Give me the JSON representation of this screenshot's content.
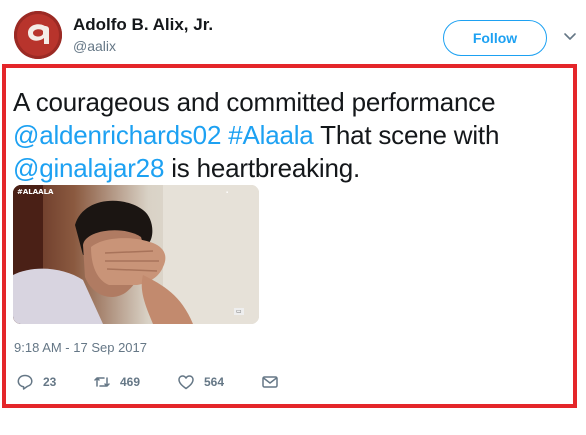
{
  "author": {
    "name": "Adolfo B. Alix, Jr.",
    "handle": "@aalix",
    "avatar_letter": "a"
  },
  "follow_label": "Follow",
  "tweet": {
    "segments": [
      {
        "text": "A courageous and committed performance ",
        "type": "text"
      },
      {
        "text": "@aldenrichards02",
        "type": "mention"
      },
      {
        "text": " ",
        "type": "text"
      },
      {
        "text": "#Alaala",
        "type": "hashtag"
      },
      {
        "text": " That scene with ",
        "type": "text"
      },
      {
        "text": "@ginalajar28",
        "type": "mention"
      },
      {
        "text": " is heartbreaking.",
        "type": "text"
      }
    ]
  },
  "media": {
    "tag_text": "#ALAALA"
  },
  "timestamp": "9:18 AM - 17 Sep 2017",
  "actions": {
    "reply_count": "23",
    "retweet_count": "469",
    "like_count": "564"
  },
  "colors": {
    "accent": "#1da1f2",
    "highlight_border": "#e4262a",
    "muted": "#657786",
    "avatar_bg": "#9b2a24"
  },
  "icons": [
    "chevron-down-icon",
    "reply-icon",
    "retweet-icon",
    "heart-icon",
    "mail-icon"
  ]
}
